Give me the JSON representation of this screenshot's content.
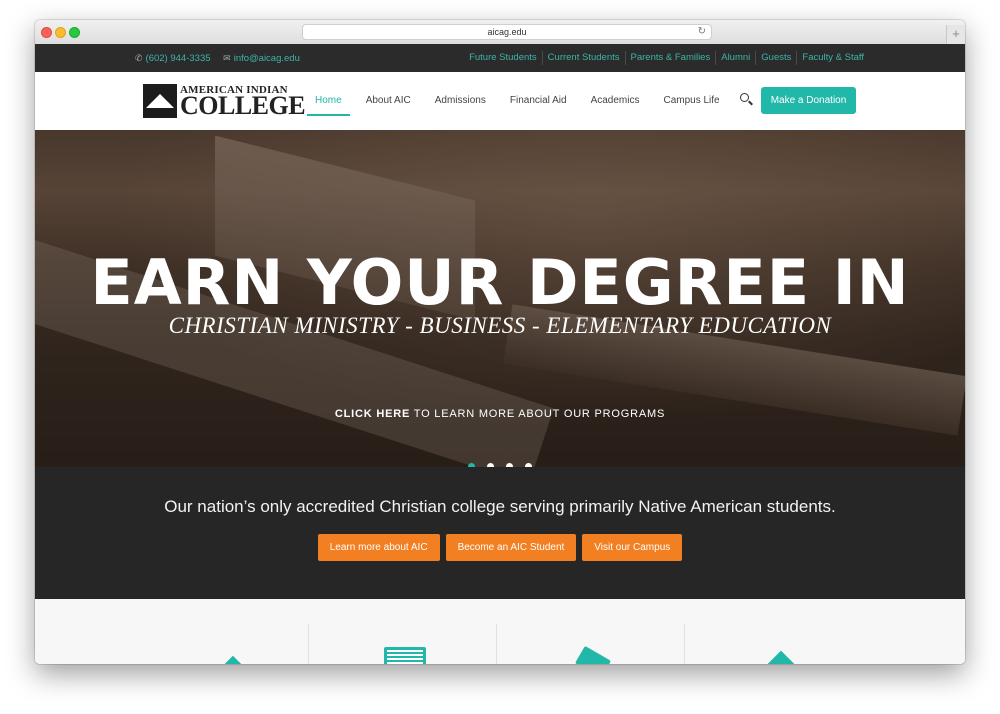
{
  "browser": {
    "url": "aicag.edu"
  },
  "topbar": {
    "phone": "(602) 944-3335",
    "email": "info@aicag.edu",
    "links": [
      "Future Students",
      "Current Students",
      "Parents & Families",
      "Alumni",
      "Guests",
      "Faculty & Staff"
    ]
  },
  "header": {
    "logo_top": "AMERICAN INDIAN",
    "logo_bottom": "COLLEGE",
    "nav": [
      "Home",
      "About AIC",
      "Admissions",
      "Financial Aid",
      "Academics",
      "Campus Life"
    ],
    "active_nav": "Home",
    "donate_label": "Make a Donation"
  },
  "hero": {
    "headline": "EARN YOUR DEGREE IN",
    "subline": "CHRISTIAN MINISTRY - BUSINESS - ELEMENTARY EDUCATION",
    "cta_bold": "CLICK HERE",
    "cta_rest": " TO LEARN MORE ABOUT OUR PROGRAMS",
    "slides": 4,
    "active_slide": 1
  },
  "band": {
    "tagline": "Our nation’s only accredited Christian college serving primarily Native American students.",
    "buttons": [
      "Learn more about AIC",
      "Become an AIC Student",
      "Visit our Campus"
    ]
  },
  "features": {
    "icons": [
      "pencil-icon",
      "book-icon",
      "tag-icon",
      "graduation-cap-icon"
    ]
  },
  "colors": {
    "accent": "#22b8a9",
    "orange": "#f27f21",
    "dark": "#262626",
    "topbar": "#2b2b2b"
  }
}
